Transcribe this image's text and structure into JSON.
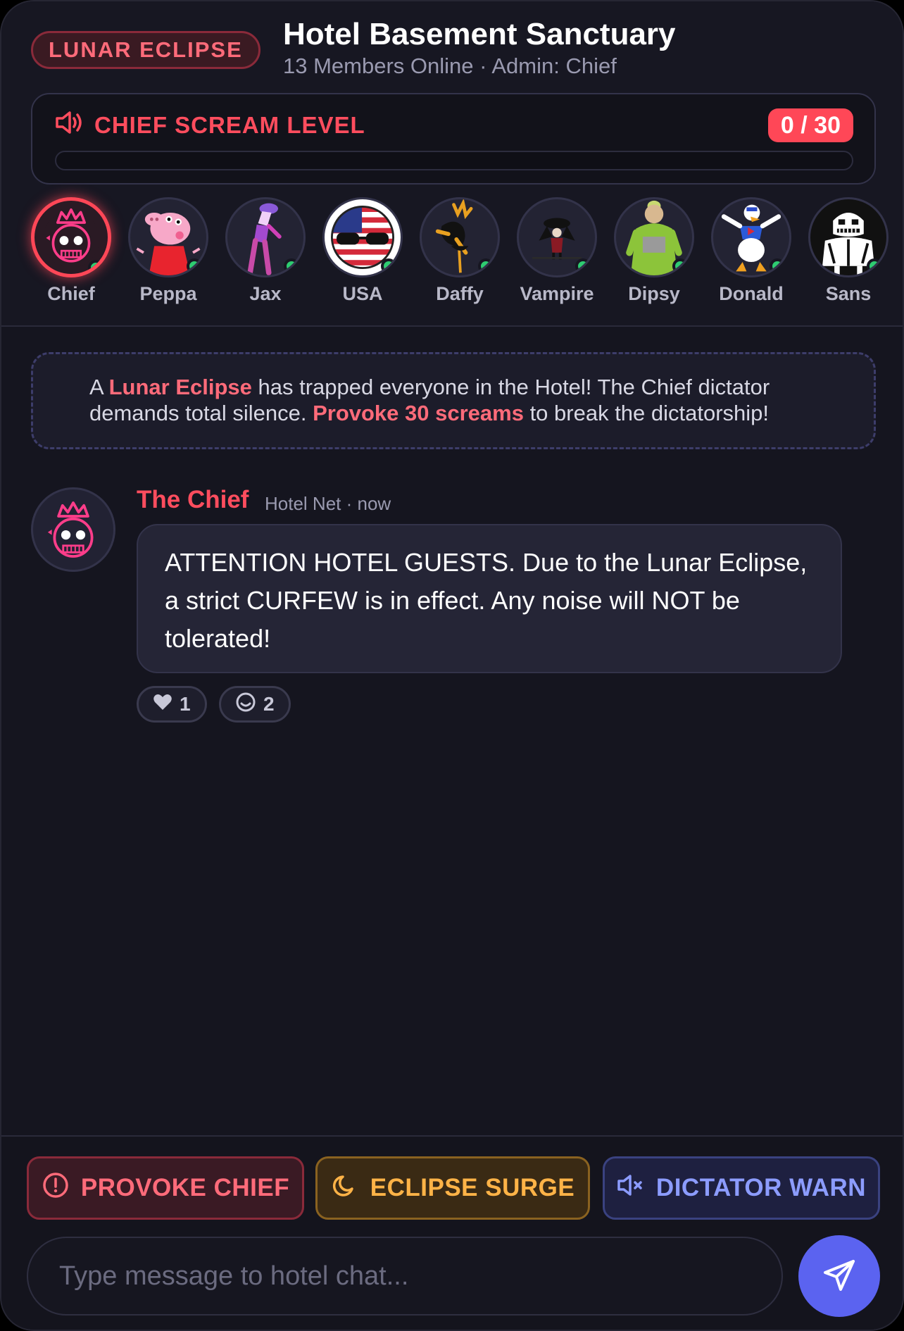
{
  "header": {
    "badge": "LUNAR ECLIPSE",
    "title": "Hotel Basement Sanctuary",
    "subtitle": "13 Members Online · Admin: Chief"
  },
  "scream": {
    "label": "CHIEF SCREAM LEVEL",
    "count": "0 / 30",
    "current": 0,
    "max": 30,
    "icon": "speaker-loud-icon"
  },
  "members": [
    {
      "name": "Chief",
      "icon": "chief-avatar",
      "active": true
    },
    {
      "name": "Peppa",
      "icon": "peppa-avatar"
    },
    {
      "name": "Jax",
      "icon": "jax-avatar"
    },
    {
      "name": "USA",
      "icon": "usa-avatar"
    },
    {
      "name": "Daffy",
      "icon": "daffy-avatar"
    },
    {
      "name": "Vampire",
      "icon": "vampire-avatar"
    },
    {
      "name": "Dipsy",
      "icon": "dipsy-avatar"
    },
    {
      "name": "Donald",
      "icon": "donald-avatar"
    },
    {
      "name": "Sans",
      "icon": "sans-avatar"
    }
  ],
  "notice": {
    "part1": "A ",
    "highlight1": "Lunar Eclipse",
    "part2": " has trapped everyone in the Hotel! The Chief dictator demands total silence. ",
    "highlight2": "Provoke 30 screams",
    "part3": " to break the dictatorship!"
  },
  "message": {
    "author": "The Chief",
    "meta": "Hotel Net · now",
    "text": "ATTENTION HOTEL GUESTS. Due to the Lunar Eclipse, a strict CURFEW is in effect. Any noise will NOT be tolerated!",
    "reactions": [
      {
        "icon": "heart-icon",
        "count": "1"
      },
      {
        "icon": "smile-icon",
        "count": "2"
      }
    ]
  },
  "actions": {
    "provoke": "PROVOKE CHIEF",
    "eclipse": "ECLIPSE SURGE",
    "warn": "DICTATOR WARN"
  },
  "composer": {
    "placeholder": "Type message to hotel chat...",
    "value": ""
  },
  "colors": {
    "accent": "#ff4757",
    "eclipse": "#ffb347",
    "warn": "#8c9cff",
    "send": "#5b63f0",
    "online": "#2ecc71"
  }
}
